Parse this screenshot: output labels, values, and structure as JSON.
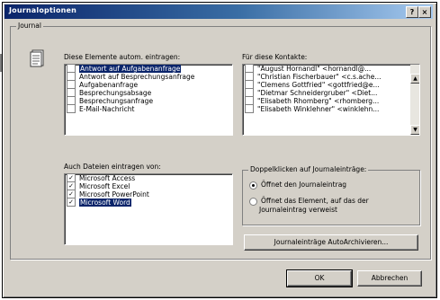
{
  "window": {
    "title": "Journaloptionen"
  },
  "journal_group": {
    "label": "Journal"
  },
  "elements": {
    "label_pre": "D",
    "label_u": "",
    "label": "Diese Elemente autom. eintragen:",
    "items": [
      {
        "text": "Antwort auf Aufgabenanfrage",
        "checked": false,
        "selected": true
      },
      {
        "text": "Antwort auf Besprechungsanfrage",
        "checked": false
      },
      {
        "text": "Aufgabenanfrage",
        "checked": false
      },
      {
        "text": "Besprechungsabsage",
        "checked": false
      },
      {
        "text": "Besprechungsanfrage",
        "checked": false
      },
      {
        "text": "E-Mail-Nachricht",
        "checked": false
      }
    ]
  },
  "contacts": {
    "label": "Für diese Kontakte:",
    "items": [
      {
        "text": "\"August Hornandl\" <hornandl@..."
      },
      {
        "text": "\"Christian Fischerbauer\" <c.s.ache..."
      },
      {
        "text": "\"Clemens Gottfried\" <gottfried@e..."
      },
      {
        "text": "\"Dietmar Schneidergruber\" <Diet..."
      },
      {
        "text": "\"Elisabeth Rhomberg\" <rhomberg..."
      },
      {
        "text": "\"Elisabeth Winklehner\" <winklehn..."
      }
    ]
  },
  "files": {
    "label": "Auch Dateien eintragen von:",
    "items": [
      {
        "text": "Microsoft Access",
        "checked": true
      },
      {
        "text": "Microsoft Excel",
        "checked": true
      },
      {
        "text": "Microsoft PowerPoint",
        "checked": true
      },
      {
        "text": "Microsoft Word",
        "checked": true,
        "selected": true
      }
    ]
  },
  "doubleclick": {
    "label": "Doppelklicken auf Journaleinträge:",
    "option1": "Öffnet den Journaleintrag",
    "option2_line1": "Öffnet das Element, auf das der",
    "option2_line2": "Journaleintrag verweist",
    "selected": 1
  },
  "buttons": {
    "autoarchive": "Journaleinträge AutoArchivieren...",
    "ok": "OK",
    "cancel": "Abbrechen"
  },
  "icons": {
    "help": "?",
    "close": "×",
    "check": "✓",
    "up": "▲",
    "down": "▼"
  }
}
